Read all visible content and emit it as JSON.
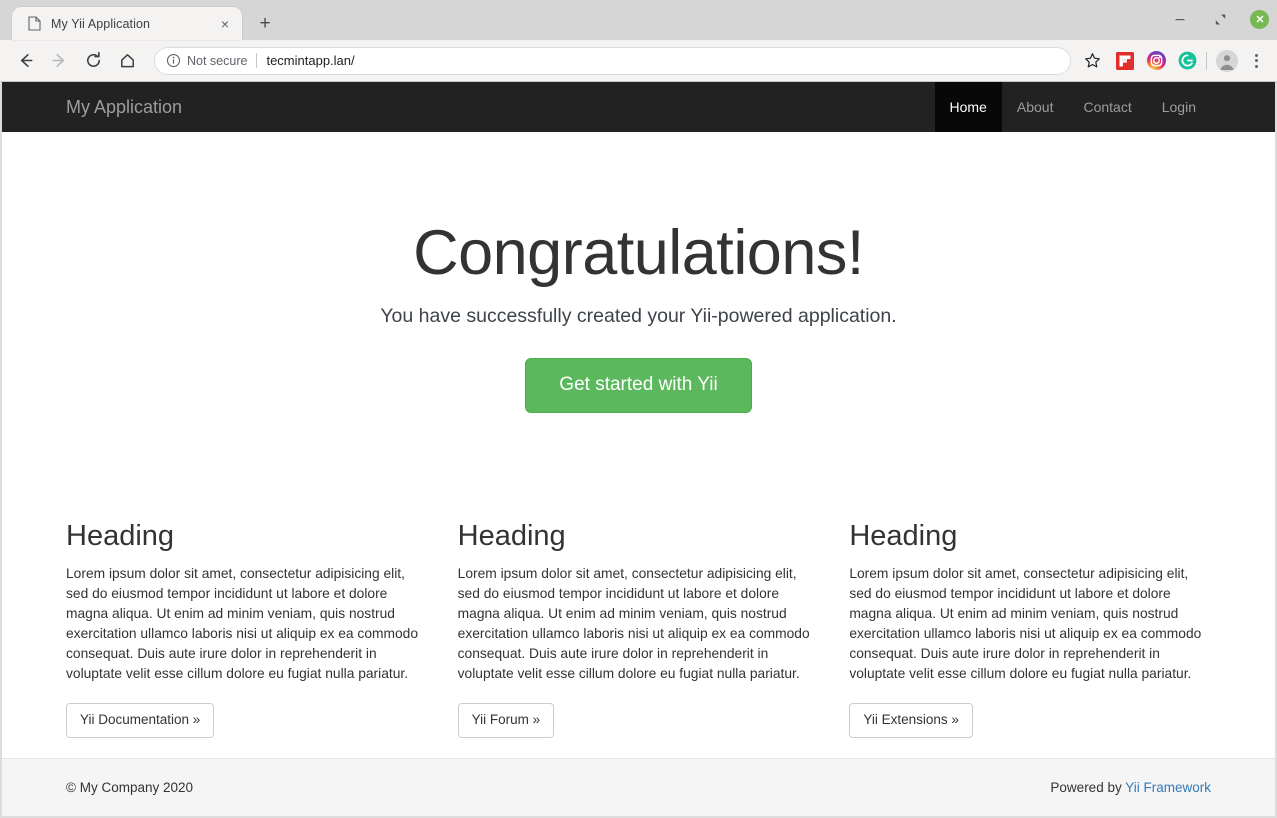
{
  "browser": {
    "tab": {
      "title": "My Yii Application",
      "favicon_icon": "page-icon",
      "close_icon": "×"
    },
    "new_tab_label": "+",
    "window_controls": {
      "minimize_label": "–",
      "maximize_label": "⤡",
      "close_label": "×"
    },
    "toolbar": {
      "back_label": "←",
      "forward_label": "→",
      "reload_label": "⟳",
      "home_label": "⌂",
      "security_text": "Not secure",
      "url": "tecmintapp.lan/",
      "star_label": "☆",
      "extensions": [
        "flipboard-icon",
        "instagram-icon",
        "grammarly-icon"
      ],
      "grammarly_letter": "G",
      "profile_icon": "avatar-icon",
      "menu_icon": "three-dot-menu-icon"
    }
  },
  "page": {
    "navbar": {
      "brand": "My Application",
      "links": [
        {
          "label": "Home",
          "active": true
        },
        {
          "label": "About",
          "active": false
        },
        {
          "label": "Contact",
          "active": false
        },
        {
          "label": "Login",
          "active": false
        }
      ]
    },
    "jumbotron": {
      "heading": "Congratulations!",
      "lead": "You have successfully created your Yii-powered application.",
      "cta_label": "Get started with Yii"
    },
    "columns": [
      {
        "heading": "Heading",
        "text": "Lorem ipsum dolor sit amet, consectetur adipisicing elit, sed do eiusmod tempor incididunt ut labore et dolore magna aliqua. Ut enim ad minim veniam, quis nostrud exercitation ullamco laboris nisi ut aliquip ex ea commodo consequat. Duis aute irure dolor in reprehenderit in voluptate velit esse cillum dolore eu fugiat nulla pariatur.",
        "button_label": "Yii Documentation »"
      },
      {
        "heading": "Heading",
        "text": "Lorem ipsum dolor sit amet, consectetur adipisicing elit, sed do eiusmod tempor incididunt ut labore et dolore magna aliqua. Ut enim ad minim veniam, quis nostrud exercitation ullamco laboris nisi ut aliquip ex ea commodo consequat. Duis aute irure dolor in reprehenderit in voluptate velit esse cillum dolore eu fugiat nulla pariatur.",
        "button_label": "Yii Forum »"
      },
      {
        "heading": "Heading",
        "text": "Lorem ipsum dolor sit amet, consectetur adipisicing elit, sed do eiusmod tempor incididunt ut labore et dolore magna aliqua. Ut enim ad minim veniam, quis nostrud exercitation ullamco laboris nisi ut aliquip ex ea commodo consequat. Duis aute irure dolor in reprehenderit in voluptate velit esse cillum dolore eu fugiat nulla pariatur.",
        "button_label": "Yii Extensions »"
      }
    ],
    "footer": {
      "copyright": "© My Company 2020",
      "powered_prefix": "Powered by ",
      "powered_link": "Yii Framework"
    }
  },
  "colors": {
    "navbar_bg": "#222222",
    "navbar_active_bg": "#080808",
    "cta_green": "#5cb85c",
    "link_blue": "#337ab7",
    "footer_bg": "#f5f5f5",
    "window_close_green": "#76b852"
  }
}
